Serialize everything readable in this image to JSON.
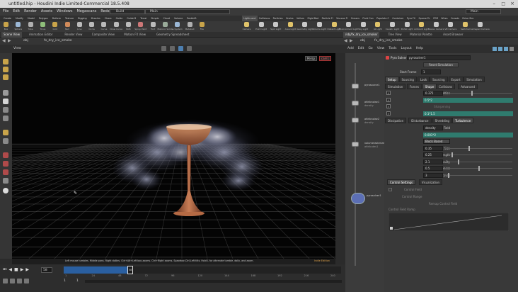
{
  "window": {
    "title": "untitled.hip - Houdini Indie Limited-Commercial 18.5.408"
  },
  "menubar": {
    "items": [
      "File",
      "Edit",
      "Render",
      "Assets",
      "Windows",
      "Megascans",
      "Redshift",
      "Help"
    ],
    "build_label": "Build",
    "desktop_label": "Main",
    "desktop_label_right": "Main"
  },
  "shelf": {
    "tabs": [
      "Create",
      "Modify",
      "Model",
      "Polygon",
      "Deform",
      "Texture",
      "Rigging",
      "Muscles",
      "Chara",
      "Guide",
      "Guide B",
      "Terrai",
      "Simple",
      "Cloud",
      "Volume",
      "Redshift"
    ],
    "tabs_right": [
      "Lights and",
      "Collisions",
      "Particles",
      "Grains",
      "Vellum",
      "Rigid Bod",
      "Particle Fl",
      "Viscous Fl",
      "Oceans",
      "Fluid Con",
      "Populate C",
      "Container",
      "Pyro FX",
      "Sparse Fir",
      "FEM",
      "Wires",
      "Crowds",
      "Drive Sim"
    ],
    "tools": [
      "Box",
      "Sphere",
      "Tube",
      "Torus",
      "Grid",
      "Null",
      "Line",
      "Circle",
      "Curve",
      "Draw Curve",
      "Path",
      "Spray Paint",
      "Font",
      "Platonic Solids",
      "L-System",
      "Metaball",
      "File"
    ],
    "tools_right": [
      "Camera",
      "Point Light",
      "Spot Light",
      "Area Light",
      "Geometry Light",
      "Volume Light",
      "Distant Light",
      "Environment Light",
      "Sky Light",
      "GI Light",
      "Caustic Light",
      "Portal Light",
      "Ambient Light",
      "Stereo Camera",
      "VR Camera",
      "Switcher",
      "Gamepad Camera"
    ]
  },
  "pane_tabs_left": [
    "Scene View",
    "Animation Editor",
    "Render View",
    "Composite View",
    "Motion FX View",
    "Geometry Spreadsheet"
  ],
  "pane_tabs_right": [
    "/obj/fx_dry_ice_smoke/",
    "Tree View",
    "Material Palette",
    "Asset Browser"
  ],
  "viewport": {
    "path_obj": "obj",
    "path_node": "fx_dry_ice_smoke",
    "view_label": "View",
    "persp_label": "Persp",
    "cam_label": "cam1",
    "status_message": "Left mouse tumbles. Middle pans. Right dollies. Ctrl+Alt+Left box-zooms. Ctrl+Right zooms. Spacebar-Ctrl-Left tilts. Hold L for alternate tumble, dolly, and zoom.",
    "indie_label": "Indie Edition"
  },
  "network": {
    "path_obj": "obj",
    "path_node": "fx_dry_ice_smoke",
    "menu": [
      "Add",
      "Edit",
      "Go",
      "View",
      "Tools",
      "Layout",
      "Help"
    ],
    "nodes": [
      {
        "name": "pyrosource1"
      },
      {
        "name": "attribnoise1",
        "sub": "density"
      },
      {
        "name": "attribnoise2",
        "sub": "density"
      },
      {
        "name": "volumerasterize",
        "sub": "attributes1"
      },
      {
        "name": "pyrosolver1"
      }
    ]
  },
  "params": {
    "node_type": "Pyro Solver",
    "node_name": "pyrosolver1",
    "reset_label": "Reset Simulation",
    "start_frame_label": "Start Frame",
    "start_frame": "1",
    "tabs": [
      "Setup",
      "Sourcing",
      "Look",
      "Sourcing",
      "Export",
      "Simulation"
    ],
    "subtabs": [
      "Simulation",
      "Forces",
      "Shape",
      "Collisions",
      "Advanced"
    ],
    "rows": [
      {
        "label": "Dissipation",
        "value": "0.375",
        "slider": 0.4
      },
      {
        "label": "Disturbance",
        "value": "0.5*2"
      },
      {
        "label": "Sharpening",
        "value": ""
      },
      {
        "label": "Turbulence",
        "value": "0.1*1.5"
      }
    ],
    "shape_tabs": [
      "Dissipation",
      "Disturbance",
      "Shredding",
      "Turbulence"
    ],
    "turb_rows": [
      {
        "label": "Threshold Field",
        "value": "density"
      },
      {
        "label": "Cutoff",
        "value": "0.003*2"
      },
      {
        "label": "Mode",
        "value": "Block Based"
      },
      {
        "label": "Base Block Size",
        "value": "0.35",
        "slider": 0.35
      },
      {
        "label": "Pulse Length",
        "value": "0.25",
        "slider": 0.1
      },
      {
        "label": "Locality",
        "value": "2.1",
        "slider": 0.2
      },
      {
        "label": "Roughness",
        "value": "0.5",
        "slider": 0.5
      },
      {
        "label": "Max Octaves",
        "value": "3",
        "slider": 0.05
      }
    ],
    "control_tabs": [
      "Control Settings",
      "Visualization"
    ],
    "control_field_label": "Control Field",
    "control_range_label": "Control Range",
    "remap_label": "Remap Control Field",
    "ramp_label": "Control Field Ramp"
  },
  "timeline": {
    "frame": "58",
    "ticks": [
      "1",
      "24",
      "48",
      "72",
      "96",
      "120",
      "144",
      "168",
      "192",
      "216",
      "240"
    ],
    "current_marker": "58",
    "start": "1",
    "end": "240",
    "end2": "240",
    "keys_label": "0 keys, 0/0 channels",
    "keys_all": "Key All Channels",
    "auto_update": "Auto Update",
    "obj_path": "/obj/fx_dry_ice...",
    "playhead": 0.24
  }
}
